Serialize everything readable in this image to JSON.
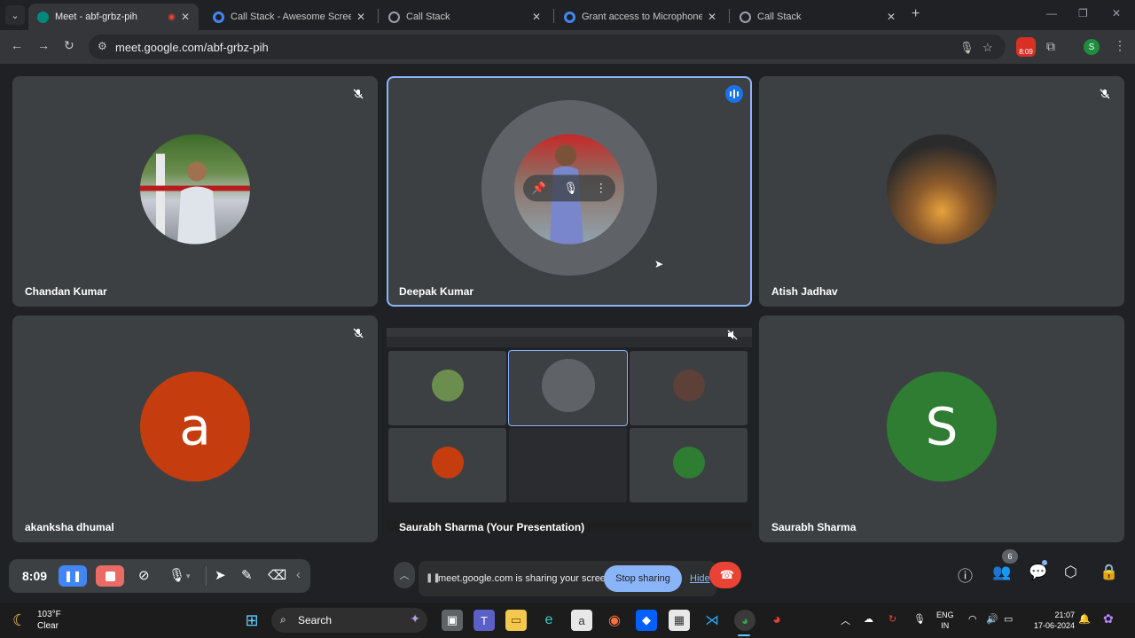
{
  "browser": {
    "tabs": [
      {
        "title": "Meet - abf-grbz-pih",
        "active": true,
        "favicon_color": "#00897b"
      },
      {
        "title": "Call Stack - Awesome Screensh",
        "active": false,
        "favicon_color": "#4285f4"
      },
      {
        "title": "Call Stack",
        "active": false,
        "favicon_color": "#9aa0a6"
      },
      {
        "title": "Grant access to Microphone/Ca",
        "active": false,
        "favicon_color": "#4285f4"
      },
      {
        "title": "Call Stack",
        "active": false,
        "favicon_color": "#9aa0a6"
      }
    ],
    "url": "meet.google.com/abf-grbz-pih",
    "extension_badge": "8:09",
    "profile_initial": "S"
  },
  "meet": {
    "participants": [
      {
        "name": "Chandan Kumar",
        "muted": true,
        "avatar_type": "photo",
        "avatar_color": "#6b8e4e"
      },
      {
        "name": "Deepak Kumar",
        "muted": false,
        "speaking": true,
        "avatar_type": "photo",
        "avatar_color": "#8d6e63"
      },
      {
        "name": "Atish Jadhav",
        "muted": true,
        "avatar_type": "photo",
        "avatar_color": "#5d4037"
      },
      {
        "name": "akanksha dhumal",
        "muted": true,
        "avatar_type": "letter",
        "letter": "a",
        "avatar_color": "#c53d0e"
      },
      {
        "name": "Saurabh Sharma (Your Presentation)",
        "muted": true,
        "avatar_type": "presentation"
      },
      {
        "name": "Saurabh Sharma",
        "muted": false,
        "avatar_type": "letter",
        "letter": "S",
        "avatar_color": "#2e7d32"
      }
    ],
    "recorder": {
      "time": "8:09"
    },
    "sharing_bar": {
      "message": "meet.google.com is sharing your screen.",
      "stop_label": "Stop sharing",
      "hide_label": "Hide"
    },
    "people_count": "6"
  },
  "taskbar": {
    "weather_temp": "103°F",
    "weather_desc": "Clear",
    "search_label": "Search",
    "lang_top": "ENG",
    "lang_bottom": "IN",
    "time": "21:07",
    "date": "17-06-2024"
  }
}
